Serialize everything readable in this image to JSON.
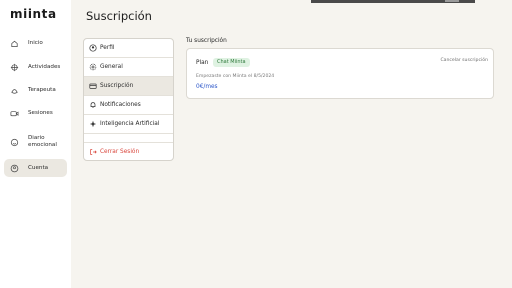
{
  "app": {
    "logo": "miinta"
  },
  "sidebar": {
    "items": [
      {
        "label": "Inicio",
        "icon": "home-icon"
      },
      {
        "label": "Actividades",
        "icon": "activities-icon"
      },
      {
        "label": "Terapeuta",
        "icon": "therapist-icon"
      },
      {
        "label": "Sesiones",
        "icon": "video-sessions-icon"
      },
      {
        "label": "Diario\nemocional",
        "icon": "emotion-diary-icon"
      },
      {
        "label": "Cuenta",
        "icon": "account-icon"
      }
    ],
    "active": "Cuenta"
  },
  "page": {
    "title": "Suscripción"
  },
  "settings_menu": {
    "items": [
      {
        "label": "Perfil",
        "icon": "user-icon"
      },
      {
        "label": "General",
        "icon": "gear-icon"
      },
      {
        "label": "Suscripción",
        "icon": "card-icon"
      },
      {
        "label": "Notificaciones",
        "icon": "bell-icon"
      },
      {
        "label": "Inteligencia Artificial",
        "icon": "sparkle-icon"
      }
    ],
    "selected": "Suscripción",
    "logout": {
      "label": "Cerrar Sesión",
      "icon": "logout-icon"
    }
  },
  "subscription": {
    "section_title": "Tu suscripción",
    "plan_label": "Plan",
    "plan_name": "Chat Miinta",
    "cancel_label": "Cancelar suscripción",
    "since": "Empezaste con Miinta el 8/5/2024",
    "price": "0€/mes"
  },
  "colors": {
    "accent_blue": "#2b56c9",
    "danger": "#d9453b",
    "badge_bg": "#dff2e2",
    "badge_text": "#2f7a3c",
    "active_bg": "#ebe8e1"
  }
}
